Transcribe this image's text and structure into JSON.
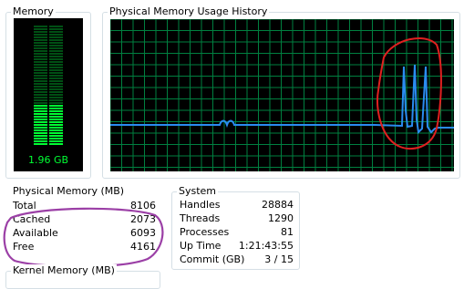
{
  "memory": {
    "title": "Memory",
    "usage_text": "1.96 GB",
    "usage_fraction": 0.34,
    "colors": {
      "bar_on": "#00ff33",
      "bar_off": "#004f14",
      "text": "#00ff33"
    }
  },
  "history": {
    "title": "Physical Memory Usage History",
    "colors": {
      "grid": "#008040",
      "line": "#2a8cf0",
      "background": "#000000"
    },
    "annotation_color": "#e02020"
  },
  "physical_memory": {
    "title": "Physical Memory (MB)",
    "rows": [
      {
        "label": "Total",
        "value": "8106"
      },
      {
        "label": "Cached",
        "value": "2073"
      },
      {
        "label": "Available",
        "value": "6093"
      },
      {
        "label": "Free",
        "value": "4161"
      }
    ],
    "annotation_color": "#9b3fa6"
  },
  "system": {
    "title": "System",
    "rows": [
      {
        "label": "Handles",
        "value": "28884"
      },
      {
        "label": "Threads",
        "value": "1290"
      },
      {
        "label": "Processes",
        "value": "81"
      },
      {
        "label": "Up Time",
        "value": "1:21:43:55"
      },
      {
        "label": "Commit (GB)",
        "value": "3 / 15"
      }
    ]
  },
  "kernel_memory": {
    "title": "Kernel Memory (MB)"
  }
}
